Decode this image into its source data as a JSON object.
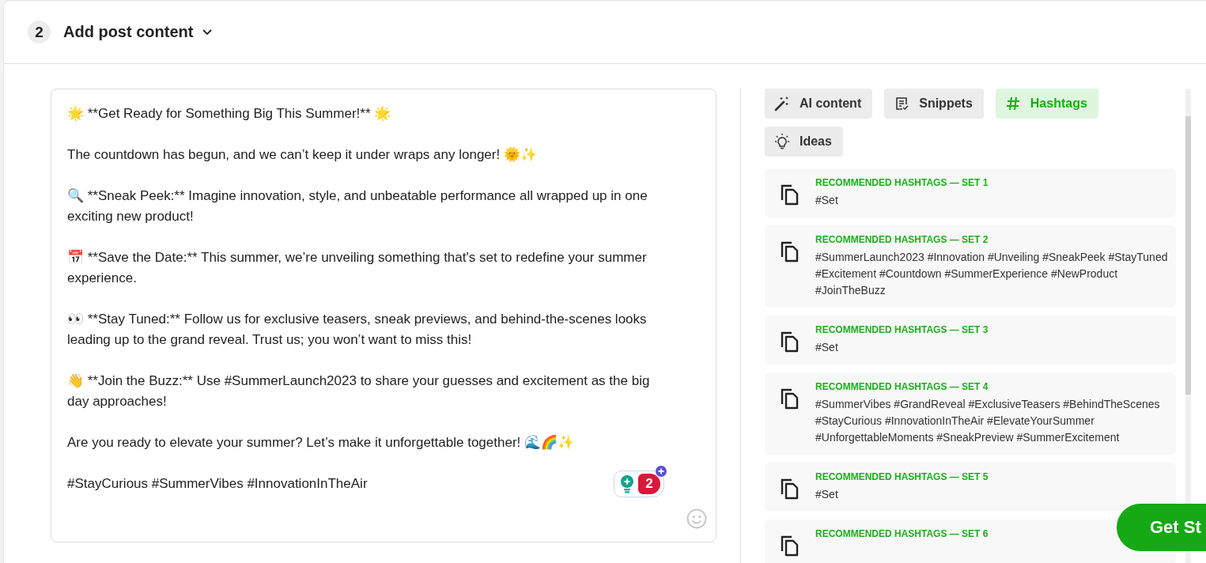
{
  "section": {
    "step": "2",
    "title": "Add post content",
    "expanded": true
  },
  "editor": {
    "paragraphs": [
      "🌟 **Get Ready for Something Big This Summer!** 🌟",
      "The countdown has begun, and we can’t keep it under wraps any longer! 🌞✨",
      "🔍 **Sneak Peek:** Imagine innovation, style, and unbeatable performance all wrapped up in one exciting new product!",
      "📅 **Save the Date:** This summer, we’re unveiling something that's set to redefine your summer experience.",
      "👀 **Stay Tuned:** Follow us for exclusive teasers, sneak previews, and behind-the-scenes looks leading up to the grand reveal. Trust us; you won’t want to miss this!",
      "👋 **Join the Buzz:** Use #SummerLaunch2023 to share your guesses and excitement as the big day approaches!",
      "Are you ready to elevate your summer? Let’s make it unforgettable together! 🌊🌈✨",
      "#StayCurious #SummerVibes #InnovationInTheAir"
    ],
    "assistant_badge": {
      "count": "2"
    }
  },
  "tabs": [
    {
      "label": "AI content",
      "selected": false
    },
    {
      "label": "Snippets",
      "selected": false
    },
    {
      "label": "Hashtags",
      "selected": true
    },
    {
      "label": "Ideas",
      "selected": false
    }
  ],
  "hashtag_sets": [
    {
      "title": "RECOMMENDED HASHTAGS — SET 1",
      "tags": "#Set"
    },
    {
      "title": "RECOMMENDED HASHTAGS — SET 2",
      "tags": "#SummerLaunch2023 #Innovation #Unveiling #SneakPeek #StayTuned #Excitement #Countdown #SummerExperience #NewProduct #JoinTheBuzz"
    },
    {
      "title": "RECOMMENDED HASHTAGS — SET 3",
      "tags": "#Set"
    },
    {
      "title": "RECOMMENDED HASHTAGS — SET 4",
      "tags": "#SummerVibes #GrandReveal #ExclusiveTeasers #BehindTheScenes #StayCurious #InnovationInTheAir #ElevateYourSummer #UnforgettableMoments #SneakPreview #SummerExcitement"
    },
    {
      "title": "RECOMMENDED HASHTAGS — SET 5",
      "tags": "#Set"
    },
    {
      "title": "RECOMMENDED HASHTAGS — SET 6"
    }
  ],
  "cta_button": {
    "label": "Get St"
  }
}
